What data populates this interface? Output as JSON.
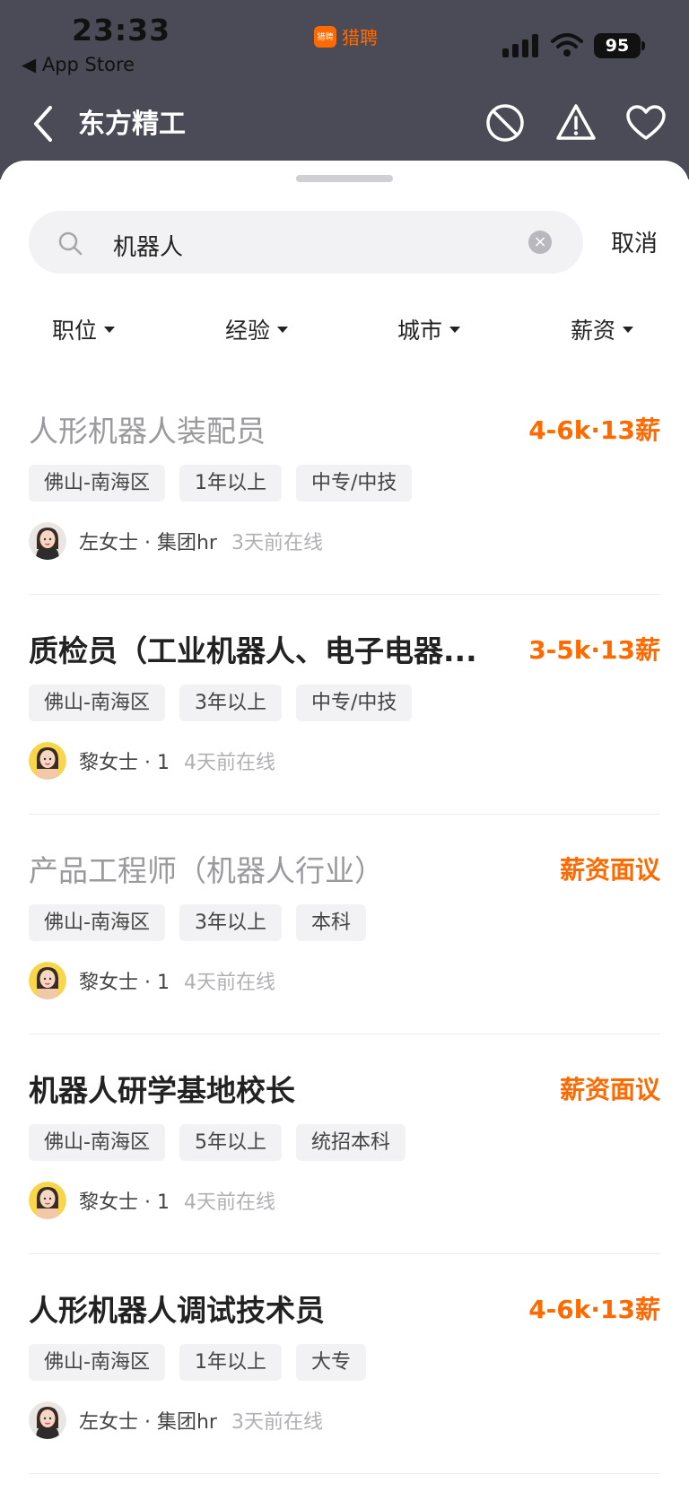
{
  "status_bar": {
    "time": "23:33",
    "back_app": "◀ App Store",
    "brand_logo": "猎聘",
    "brand_name": "猎聘",
    "battery": "95"
  },
  "nav": {
    "title": "东方精工"
  },
  "search": {
    "value": "机器人",
    "clear_icon": "×",
    "cancel_label": "取消"
  },
  "filters": [
    "职位",
    "经验",
    "城市",
    "薪资"
  ],
  "jobs": [
    {
      "title": "人形机器人装配员",
      "salary": "4-6k·13薪",
      "tags": [
        "佛山-南海区",
        "1年以上",
        "中专/中技"
      ],
      "recruiter": "左女士 · 集团hr",
      "online": "3天前在线",
      "viewed": true
    },
    {
      "title": "质检员（工业机器人、电子电器...",
      "salary": "3-5k·13薪",
      "tags": [
        "佛山-南海区",
        "3年以上",
        "中专/中技"
      ],
      "recruiter": "黎女士 · 1",
      "online": "4天前在线",
      "viewed": false
    },
    {
      "title": "产品工程师（机器人行业）",
      "salary": "薪资面议",
      "tags": [
        "佛山-南海区",
        "3年以上",
        "本科"
      ],
      "recruiter": "黎女士 · 1",
      "online": "4天前在线",
      "viewed": true
    },
    {
      "title": "机器人研学基地校长",
      "salary": "薪资面议",
      "tags": [
        "佛山-南海区",
        "5年以上",
        "统招本科"
      ],
      "recruiter": "黎女士 · 1",
      "online": "4天前在线",
      "viewed": false
    },
    {
      "title": "人形机器人调试技术员",
      "salary": "4-6k·13薪",
      "tags": [
        "佛山-南海区",
        "1年以上",
        "大专"
      ],
      "recruiter": "左女士 · 集团hr",
      "online": "3天前在线",
      "viewed": false
    }
  ],
  "colors": {
    "accent": "#ff6a00",
    "header_bg": "#4b4b58",
    "viewed_title": "#9a9a9e"
  }
}
